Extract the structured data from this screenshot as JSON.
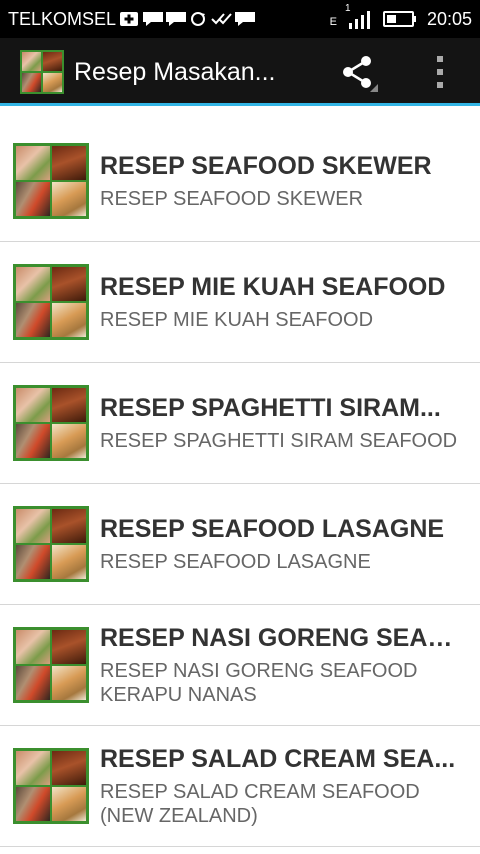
{
  "statusbar": {
    "carrier": "TELKOMSEL",
    "network": "E",
    "signal_badge": "1",
    "time": "20:05"
  },
  "actionbar": {
    "title": "Resep Masakan..."
  },
  "recipes": [
    {
      "title": "RESEP SEAFOOD SKEWER",
      "subtitle": "RESEP SEAFOOD SKEWER"
    },
    {
      "title": "RESEP MIE KUAH SEAFOOD",
      "subtitle": "RESEP MIE KUAH SEAFOOD"
    },
    {
      "title": "RESEP SPAGHETTI SIRAM...",
      "subtitle": "RESEP SPAGHETTI SIRAM SEAFOOD"
    },
    {
      "title": "RESEP SEAFOOD LASAGNE",
      "subtitle": "RESEP SEAFOOD LASAGNE"
    },
    {
      "title": "RESEP NASI GORENG SEAF...",
      "subtitle": "RESEP NASI GORENG SEAFOOD KERAPU NANAS"
    },
    {
      "title": "RESEP SALAD CREAM SEA...",
      "subtitle": "RESEP SALAD CREAM SEAFOOD (NEW ZEALAND)"
    }
  ],
  "colors": {
    "accent": "#33b5e5",
    "thumb_border": "#3b8f2e"
  }
}
